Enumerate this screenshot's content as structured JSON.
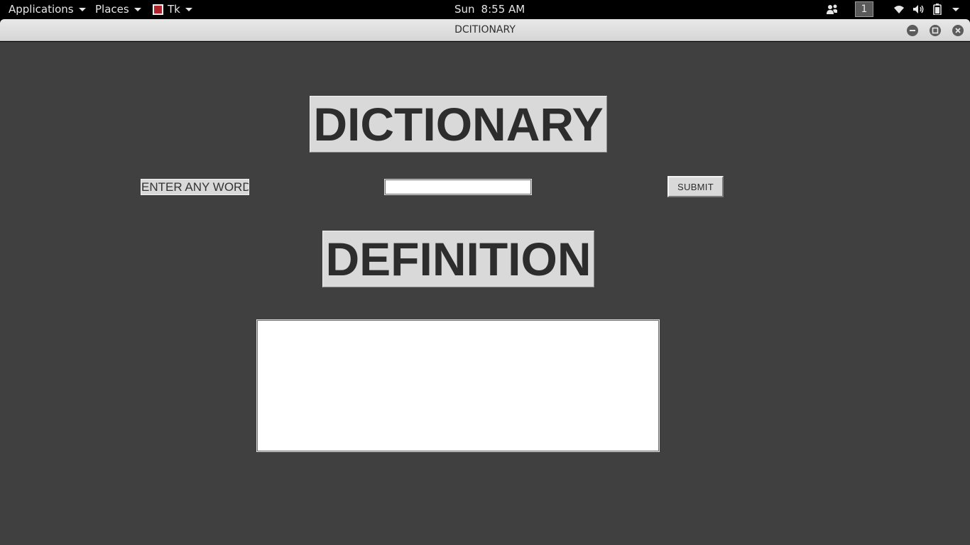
{
  "panel": {
    "applications_label": "Applications",
    "places_label": "Places",
    "app_menu_label": "Tk",
    "day": "Sun",
    "time": "8:55 AM",
    "workspace_number": "1"
  },
  "window": {
    "title": "DCITIONARY"
  },
  "app": {
    "heading": "DICTIONARY",
    "word_label": "ENTER ANY WORD",
    "word_value": "",
    "submit_label": "SUBMIT",
    "definition_heading": "DEFINITION",
    "definition_text": ""
  },
  "colors": {
    "panel_bg": "#000000",
    "app_bg": "#404040",
    "widget_bg": "#d9d9d9",
    "heading_text": "#2d2d2d"
  },
  "icons": {
    "people": "people-icon",
    "wifi": "wifi-icon",
    "volume": "volume-icon",
    "battery": "battery-icon"
  }
}
